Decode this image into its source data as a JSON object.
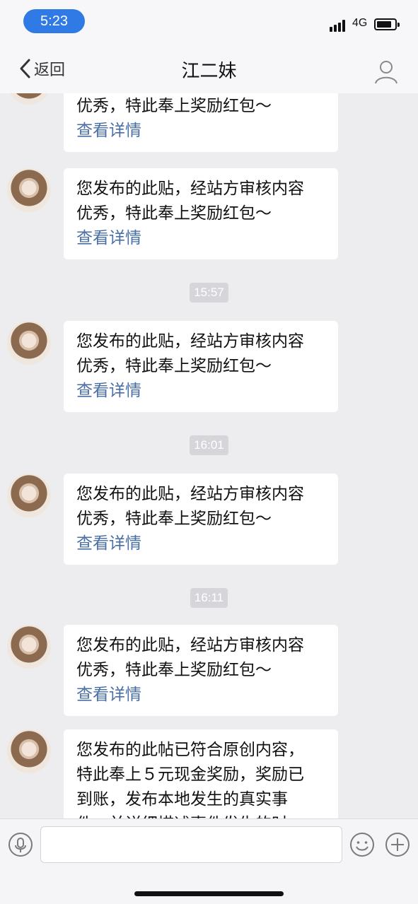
{
  "status_bar": {
    "time": "5:23",
    "network": "4G",
    "battery_level": 0.85
  },
  "nav": {
    "back_label": "返回",
    "title": "江二妹"
  },
  "items": [
    {
      "kind": "msg",
      "text": "您发布的此贴，经站方审核内容\n优秀，特此奉上奖励红包～",
      "link": "查看详情"
    },
    {
      "kind": "msg",
      "text": "您发布的此贴，经站方审核内容\n优秀，特此奉上奖励红包～",
      "link": "查看详情"
    },
    {
      "kind": "time",
      "text": "15:57"
    },
    {
      "kind": "msg",
      "text": "您发布的此贴，经站方审核内容\n优秀，特此奉上奖励红包～",
      "link": "查看详情"
    },
    {
      "kind": "time",
      "text": "16:01"
    },
    {
      "kind": "msg",
      "text": "您发布的此贴，经站方审核内容\n优秀，特此奉上奖励红包～",
      "link": "查看详情"
    },
    {
      "kind": "time",
      "text": "16:11"
    },
    {
      "kind": "msg",
      "text": "您发布的此贴，经站方审核内容\n优秀，特此奉上奖励红包～",
      "link": "查看详情"
    },
    {
      "kind": "msg",
      "text": "您发布的此帖已符合原创内容，\n特此奉上５元现金奖励，奖励已\n到账，发布本地发生的真实事\n件，并详细描述事件发生的时",
      "link": ""
    }
  ],
  "input_bar": {
    "voice_icon": "microphone-icon",
    "emoji_icon": "emoji-icon",
    "add_icon": "plus-icon",
    "placeholder": ""
  }
}
